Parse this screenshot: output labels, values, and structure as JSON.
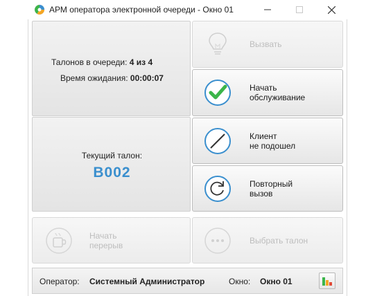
{
  "window": {
    "title": "АРМ оператора электронной очереди - Окно 01",
    "logo_icon": "app-logo-icon",
    "controls": [
      "minimize-icon",
      "maximize-icon",
      "close-icon"
    ]
  },
  "queue_info": {
    "tickets_label": "Талонов в очереди:",
    "tickets_value": "4 из 4",
    "wait_label": "Время ожидания:",
    "wait_value": "00:00:07"
  },
  "current_ticket": {
    "label": "Текущий талон:",
    "number": "B002",
    "color": "#3a8fce"
  },
  "buttons": {
    "call": {
      "label": "Вызвать",
      "icon": "lightbulb-icon",
      "enabled": false
    },
    "start_service": {
      "label": "Начать\nобслуживание",
      "icon": "checkmark-icon",
      "enabled": true
    },
    "no_show": {
      "label": "Клиент\nне подошел",
      "icon": "slash-circle-icon",
      "enabled": true
    },
    "recall": {
      "label": "Повторный\nвызов",
      "icon": "refresh-icon",
      "enabled": true
    },
    "start_break": {
      "label": "Начать\nперерыв",
      "icon": "coffee-cup-icon",
      "enabled": false
    },
    "select_ticket": {
      "label": "Выбрать талон",
      "icon": "dots-circle-icon",
      "enabled": false
    }
  },
  "status": {
    "operator_label": "Оператор:",
    "operator_value": "Системный Администратор",
    "window_label": "Окно:",
    "window_value": "Окно 01",
    "stats_icon": "bar-chart-icon"
  },
  "colors": {
    "accent": "#3a8fce",
    "check": "#3bb54a"
  }
}
